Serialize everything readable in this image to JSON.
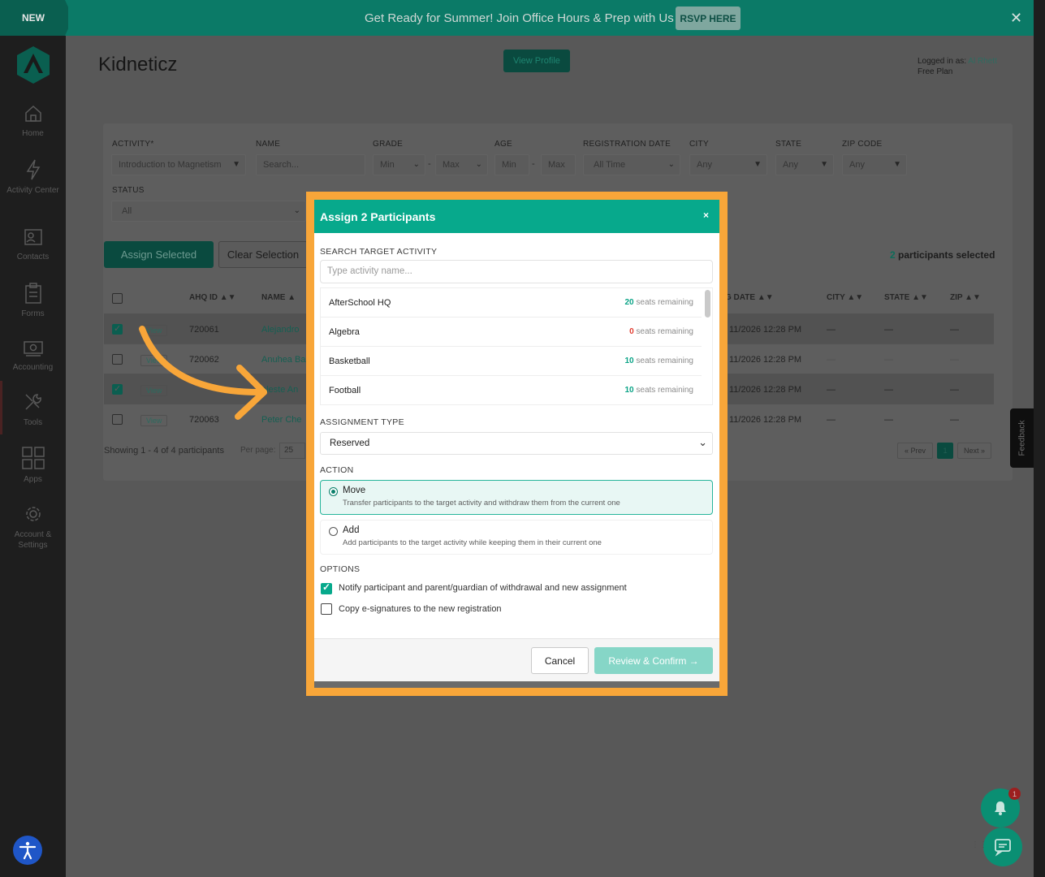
{
  "banner": {
    "badge": "NEW",
    "text": "Get Ready for Summer! Join Office Hours & Prep with Us",
    "cta": "RSVP HERE",
    "close": "✕"
  },
  "sidebar": {
    "items": [
      {
        "label": "Home",
        "icon": "home-icon"
      },
      {
        "label": "Activity Center",
        "icon": "lightning-icon"
      },
      {
        "label": "Contacts",
        "icon": "contacts-icon"
      },
      {
        "label": "Forms",
        "icon": "clipboard-icon"
      },
      {
        "label": "Accounting",
        "icon": "cash-icon"
      },
      {
        "label": "Tools",
        "icon": "tools-icon"
      },
      {
        "label": "Apps",
        "icon": "grid-icon"
      },
      {
        "label": "Account & Settings",
        "icon": "gear-icon"
      }
    ]
  },
  "header": {
    "title": "Kidneticz",
    "view_profile": "View Profile",
    "logged_in_prefix": "Logged in as: ",
    "user": "Al Rhett",
    "plan": "Free Plan"
  },
  "filters": {
    "activity_label": "ACTIVITY*",
    "activity_value": "Introduction to Magnetism",
    "name_label": "NAME",
    "name_placeholder": "Search...",
    "grade_label": "GRADE",
    "grade_min": "Min",
    "grade_max": "Max",
    "age_label": "AGE",
    "age_min": "Min",
    "age_max": "Max",
    "reg_date_label": "REGISTRATION DATE",
    "reg_date_value": "All Time",
    "city_label": "CITY",
    "city_value": "Any",
    "state_label": "STATE",
    "state_value": "Any",
    "zip_label": "ZIP CODE",
    "zip_value": "Any",
    "status_label": "STATUS",
    "status_value": "All"
  },
  "actions": {
    "assign_selected": "Assign Selected",
    "clear_selection": "Clear Selection",
    "selected_count": "2",
    "selected_suffix": " participants selected"
  },
  "table": {
    "headers": {
      "ahq_id": "AHQ ID ▲▼",
      "name": "NAME ▲",
      "reg_date": "G DATE ▲▼",
      "city": "CITY ▲▼",
      "state": "STATE ▲▼",
      "zip": "ZIP ▲▼"
    },
    "rows": [
      {
        "checked": true,
        "view": "View",
        "id": "720061",
        "name": "Alejandro",
        "date": "11/2026 12:28 PM",
        "city": "—",
        "state": "—",
        "zip": "—"
      },
      {
        "checked": false,
        "view": "View",
        "id": "720062",
        "name": "Anuhea Ba",
        "date": "11/2026 12:28 PM",
        "city": "—",
        "state": "—",
        "zip": "—"
      },
      {
        "checked": true,
        "view": "View",
        "id": "",
        "name": "eleste An",
        "date": "11/2026 12:28 PM",
        "city": "—",
        "state": "—",
        "zip": "—"
      },
      {
        "checked": false,
        "view": "View",
        "id": "720063",
        "name": "Peter Che",
        "date": "11/2026 12:28 PM",
        "city": "—",
        "state": "—",
        "zip": "—"
      }
    ],
    "showing": "Showing 1 - 4 of 4 participants",
    "per_page_label": "Per page:",
    "per_page_value": "25",
    "prev": "« Prev",
    "page": "1",
    "next": "Next »"
  },
  "feedback": "Feedback",
  "notifications": {
    "count": "1"
  },
  "modal": {
    "title": "Assign 2 Participants",
    "close": "×",
    "search_label": "SEARCH TARGET ACTIVITY",
    "search_placeholder": "Type activity name...",
    "activities": [
      {
        "name": "AfterSchool HQ",
        "seats": "20",
        "seats_text": " seats remaining"
      },
      {
        "name": "Algebra",
        "seats": "0",
        "seats_text": " seats remaining"
      },
      {
        "name": "Basketball",
        "seats": "10",
        "seats_text": " seats remaining"
      },
      {
        "name": "Football",
        "seats": "10",
        "seats_text": " seats remaining"
      }
    ],
    "assignment_type_label": "ASSIGNMENT TYPE",
    "assignment_type_value": "Reserved",
    "action_label": "ACTION",
    "action_move_title": "Move",
    "action_move_desc": "Transfer participants to the target activity and withdraw them from the current one",
    "action_add_title": "Add",
    "action_add_desc": "Add participants to the target activity while keeping them in their current one",
    "options_label": "OPTIONS",
    "option_notify": "Notify participant and parent/guardian of withdrawal and new assignment",
    "option_notify_checked": true,
    "option_copy": "Copy e-signatures to the new registration",
    "option_copy_checked": false,
    "cancel": "Cancel",
    "review": "Review & Confirm →"
  },
  "colors": {
    "accent": "#07a98c",
    "highlight": "#f8a639",
    "banner": "#0b7a67"
  }
}
